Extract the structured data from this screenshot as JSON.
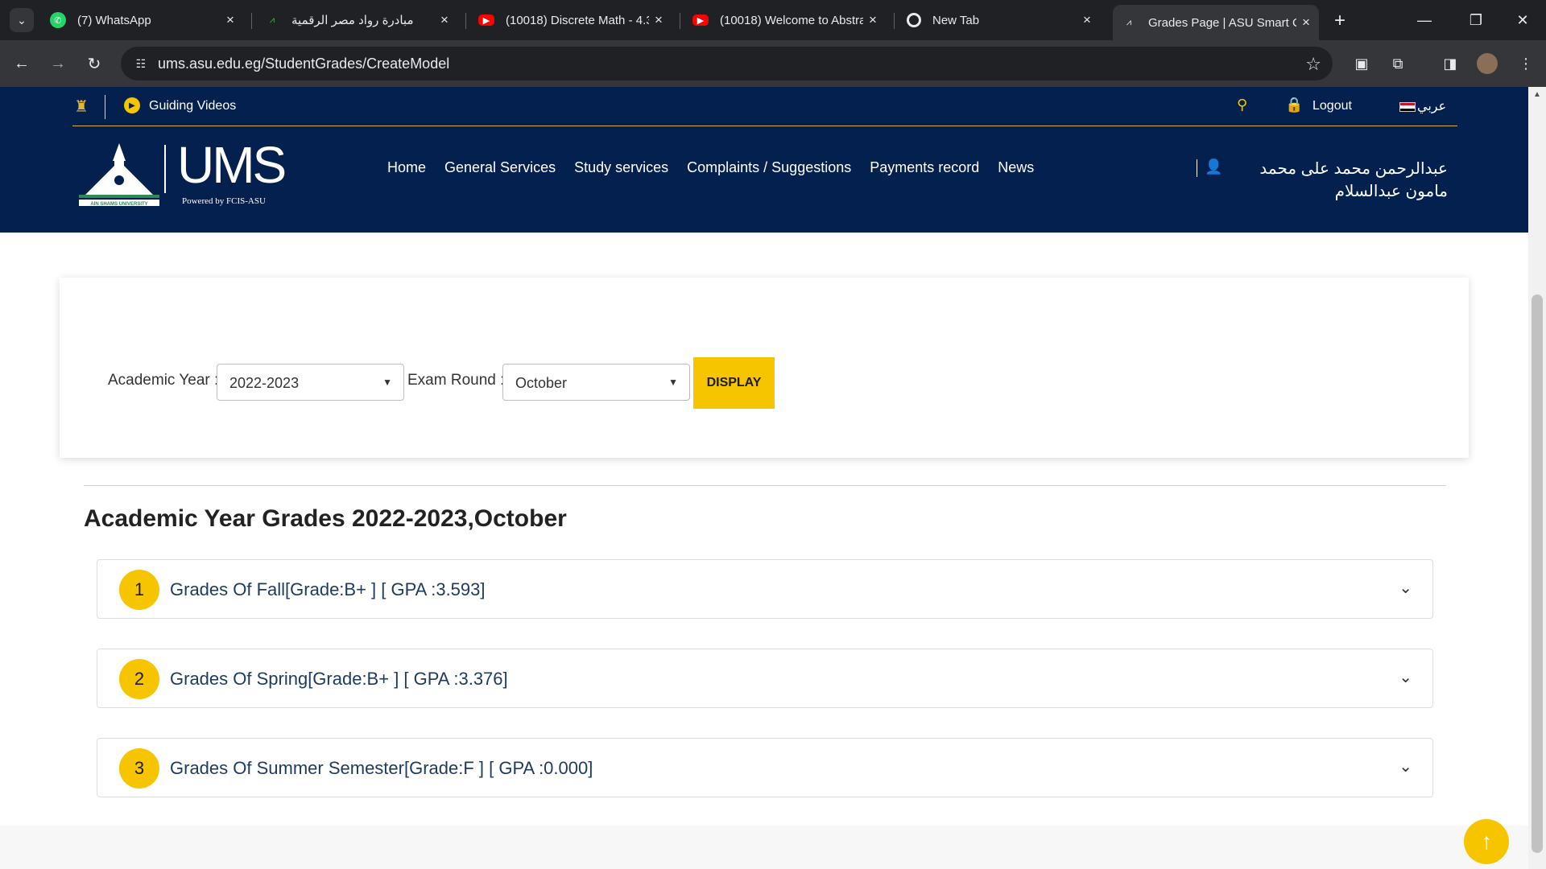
{
  "browser": {
    "tabs": [
      {
        "title": "(7) WhatsApp",
        "favicon": "whatsapp-icon",
        "color": "#25d366"
      },
      {
        "title": "مبادرة رواد مصر الرقمية",
        "favicon": "rowad-icon",
        "color": "#4caf50"
      },
      {
        "title": "(10018) Discrete Math - 4.3",
        "favicon": "youtube-icon",
        "color": "#ff0000"
      },
      {
        "title": "(10018) Welcome to Abstra",
        "favicon": "youtube-icon",
        "color": "#ff0000"
      },
      {
        "title": "New Tab",
        "favicon": "chrome-icon",
        "color": "#e8eaed"
      },
      {
        "title": "Grades Page | ASU Smart C",
        "favicon": "asu-icon",
        "color": "#e8eaed"
      }
    ],
    "url": "ums.asu.edu.eg/StudentGrades/CreateModel"
  },
  "header": {
    "guiding_videos": "Guiding Videos",
    "logout": "Logout",
    "language": "عربي",
    "logo_text": "UMS",
    "powered_by": "Powered by FCIS-ASU",
    "university_label": "AIN SHAMS UNIVERSITY",
    "nav": [
      "Home",
      "General Services",
      "Study services",
      "Complaints / Suggestions",
      "Payments record",
      "News"
    ],
    "user_name": "عبدالرحمن محمد على محمد مامون عبدالسلام"
  },
  "filter": {
    "academic_year_label": "Academic Year :",
    "academic_year_value": "2022-2023",
    "exam_round_label": "Exam Round :",
    "exam_round_value": "October",
    "display_button": "DISPLAY"
  },
  "grades": {
    "title": "Academic Year Grades 2022-2023,October",
    "semesters": [
      {
        "number": "1",
        "label": "Grades Of Fall[Grade:B+ ] [ GPA :3.593]"
      },
      {
        "number": "2",
        "label": "Grades Of Spring[Grade:B+ ] [ GPA :3.376]"
      },
      {
        "number": "3",
        "label": "Grades Of Summer Semester[Grade:F ] [ GPA :0.000]"
      }
    ]
  },
  "colors": {
    "header_bg": "#03204f",
    "accent": "#f6c500"
  }
}
